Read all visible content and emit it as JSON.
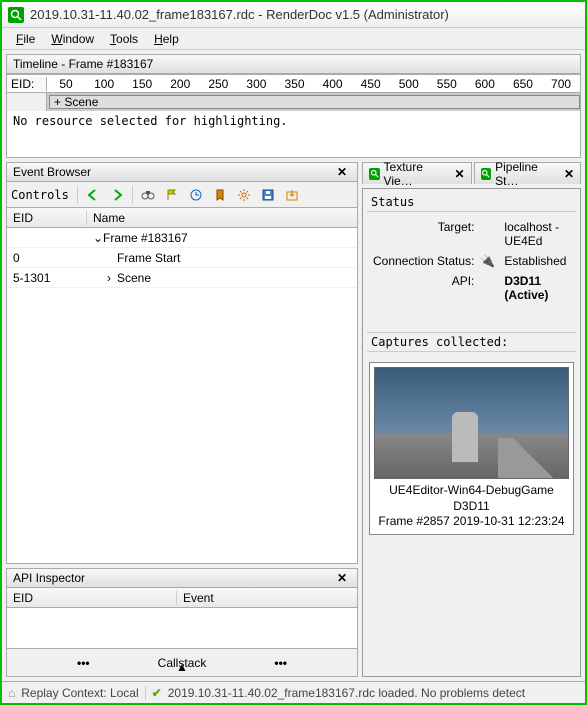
{
  "titlebar": {
    "title": "2019.10.31-11.40.02_frame183167.rdc - RenderDoc v1.5 (Administrator)"
  },
  "menubar": {
    "file": "File",
    "window": "Window",
    "tools": "Tools",
    "help": "Help"
  },
  "timeline": {
    "title": "Timeline - Frame #183167",
    "eid_label": "EID:",
    "ticks": [
      "50",
      "100",
      "150",
      "200",
      "250",
      "300",
      "350",
      "400",
      "450",
      "500",
      "550",
      "600",
      "650",
      "700"
    ],
    "scene_label": "+ Scene",
    "message": "No resource selected for highlighting."
  },
  "eventbrowser": {
    "title": "Event Browser",
    "controls_label": "Controls",
    "header": {
      "eid": "EID",
      "name": "Name"
    },
    "rows": [
      {
        "eid": "",
        "name": "Frame #183167",
        "indent": 0,
        "arrow": "v"
      },
      {
        "eid": "0",
        "name": "Frame Start",
        "indent": 1,
        "arrow": ""
      },
      {
        "eid": "5-1301",
        "name": "Scene",
        "indent": 1,
        "arrow": ">"
      }
    ]
  },
  "apiinsp": {
    "title": "API Inspector",
    "header": {
      "eid": "EID",
      "event": "Event"
    },
    "callstack": "Callstack"
  },
  "tabs": {
    "texture": "Texture Vie…",
    "pipeline": "Pipeline St…"
  },
  "status": {
    "title": "Status",
    "target_label": "Target:",
    "target_value": "localhost - UE4Ed",
    "conn_label": "Connection Status:",
    "conn_value": "Established",
    "api_label": "API:",
    "api_value": "D3D11 (Active)"
  },
  "captures": {
    "title": "Captures collected:",
    "card_line1": "UE4Editor-Win64-DebugGame",
    "card_line2": "D3D11",
    "card_line3": "Frame #2857 2019-10-31 12:23:24"
  },
  "statusbar": {
    "replay": "Replay Context: Local",
    "loaded": "2019.10.31-11.40.02_frame183167.rdc loaded. No problems detect"
  }
}
